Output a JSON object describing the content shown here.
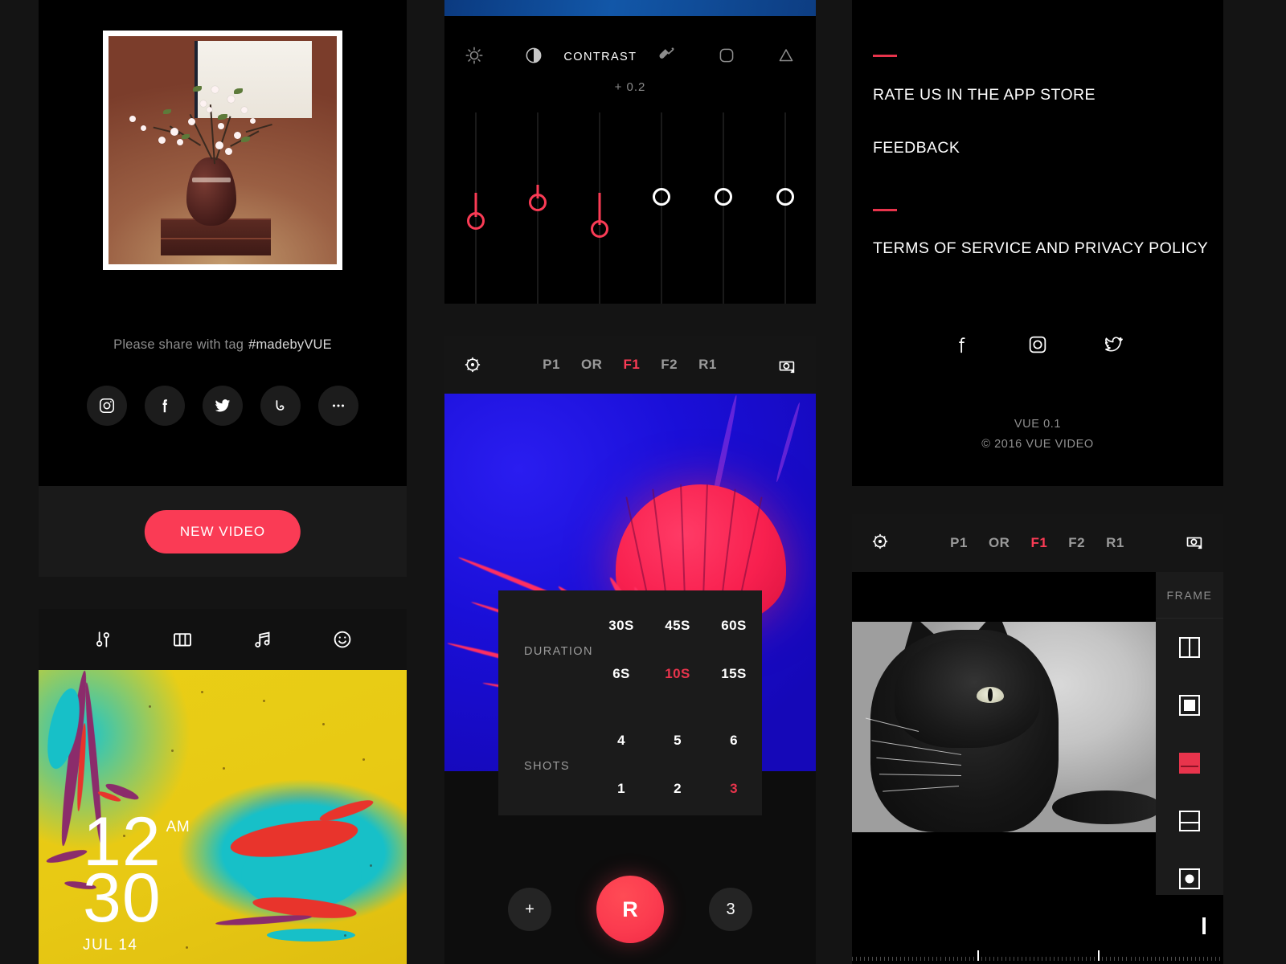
{
  "app": {
    "name": "VUE",
    "version_line": "VUE  0.1",
    "copyright": "© 2016 VUE VIDEO"
  },
  "theme": {
    "accent": "#fa3b55",
    "accent_dark": "#e8344c",
    "bg": "#141414",
    "panel_bg": "#000000",
    "panel_alt_bg": "#1a1a1a"
  },
  "share": {
    "tag_label": "Please share with tag",
    "tag_value": "#madebyVUE",
    "icons": [
      {
        "name": "instagram-icon",
        "label": "Instagram"
      },
      {
        "name": "facebook-icon",
        "label": "Facebook"
      },
      {
        "name": "twitter-icon",
        "label": "Twitter"
      },
      {
        "name": "vine-icon",
        "label": "Vine"
      },
      {
        "name": "more-icon",
        "label": "More"
      }
    ],
    "new_video_label": "NEW VIDEO"
  },
  "editor": {
    "tools": [
      {
        "name": "adjust-sliders-icon",
        "label": "Adjust"
      },
      {
        "name": "columns-frame-icon",
        "label": "Frame"
      },
      {
        "name": "music-note-icon",
        "label": "Music"
      },
      {
        "name": "smiley-face-icon",
        "label": "Sticker"
      }
    ],
    "overlay": {
      "time": "12",
      "minutes": "30",
      "ampm": "AM",
      "date": "JUL 14"
    }
  },
  "adjust": {
    "selected_label": "CONTRAST",
    "value": "+ 0.2",
    "tools": [
      {
        "name": "brightness-icon",
        "label": "Brightness"
      },
      {
        "name": "contrast-icon",
        "label": "Contrast"
      },
      {
        "name": "contrast-label",
        "label": "CONTRAST"
      },
      {
        "name": "saturation-icon",
        "label": "Saturation"
      },
      {
        "name": "vignette-icon",
        "label": "Vignette"
      },
      {
        "name": "sharpen-icon",
        "label": "Sharpen"
      }
    ],
    "sliders": [
      {
        "name": "slider-brightness",
        "value": 34,
        "active": true
      },
      {
        "name": "slider-contrast",
        "value": 52,
        "active": true
      },
      {
        "name": "slider-saturation",
        "value": 24,
        "active": true
      },
      {
        "name": "slider-highlight",
        "value": 62,
        "active": false
      },
      {
        "name": "slider-shadow",
        "value": 62,
        "active": false
      },
      {
        "name": "slider-sharpen",
        "value": 62,
        "active": false
      }
    ]
  },
  "camera": {
    "settings_icon": "gear-aperture-icon",
    "flip_icon": "camera-flip-icon",
    "modes": [
      {
        "label": "P1",
        "active": false
      },
      {
        "label": "OR",
        "active": false
      },
      {
        "label": "F1",
        "active": true
      },
      {
        "label": "F2",
        "active": false
      },
      {
        "label": "R1",
        "active": false
      }
    ],
    "duration": {
      "title": "DURATION",
      "row_top": [
        {
          "label": "30S",
          "selected": false
        },
        {
          "label": "45S",
          "selected": false
        },
        {
          "label": "60S",
          "selected": false
        }
      ],
      "row_bottom": [
        {
          "label": "6S",
          "selected": false
        },
        {
          "label": "10S",
          "selected": true
        },
        {
          "label": "15S",
          "selected": false
        }
      ]
    },
    "shots": {
      "title": "SHOTS",
      "row_top": [
        {
          "label": "4",
          "selected": false
        },
        {
          "label": "5",
          "selected": false
        },
        {
          "label": "6",
          "selected": false
        }
      ],
      "row_bottom": [
        {
          "label": "1",
          "selected": false
        },
        {
          "label": "2",
          "selected": false
        },
        {
          "label": "3",
          "selected": true
        }
      ]
    },
    "controls": {
      "add_label": "+",
      "record_label": "R",
      "count_label": "3"
    }
  },
  "about": {
    "links": [
      {
        "label": "RATE US IN THE APP STORE"
      },
      {
        "label": "FEEDBACK"
      },
      {
        "label": "TERMS OF SERVICE AND PRIVACY POLICY"
      }
    ],
    "social": [
      {
        "name": "facebook-icon",
        "label": "Facebook"
      },
      {
        "name": "instagram-icon",
        "label": "Instagram"
      },
      {
        "name": "twitter-icon",
        "label": "Twitter"
      }
    ]
  },
  "frame_picker": {
    "settings_icon": "gear-aperture-icon",
    "flip_icon": "camera-flip-icon",
    "modes": [
      {
        "label": "P1",
        "active": false
      },
      {
        "label": "OR",
        "active": false
      },
      {
        "label": "F1",
        "active": true
      },
      {
        "label": "F2",
        "active": false
      },
      {
        "label": "R1",
        "active": false
      }
    ],
    "rail_title": "FRAME",
    "options": [
      {
        "name": "frame-split-vertical",
        "selected": false
      },
      {
        "name": "frame-square-inset",
        "selected": false
      },
      {
        "name": "frame-wide-bar",
        "selected": true
      },
      {
        "name": "frame-split-horizontal",
        "selected": false
      },
      {
        "name": "frame-circle-mask",
        "selected": false
      }
    ],
    "bottom_option": {
      "name": "frame-wide-split",
      "selected": false
    }
  }
}
